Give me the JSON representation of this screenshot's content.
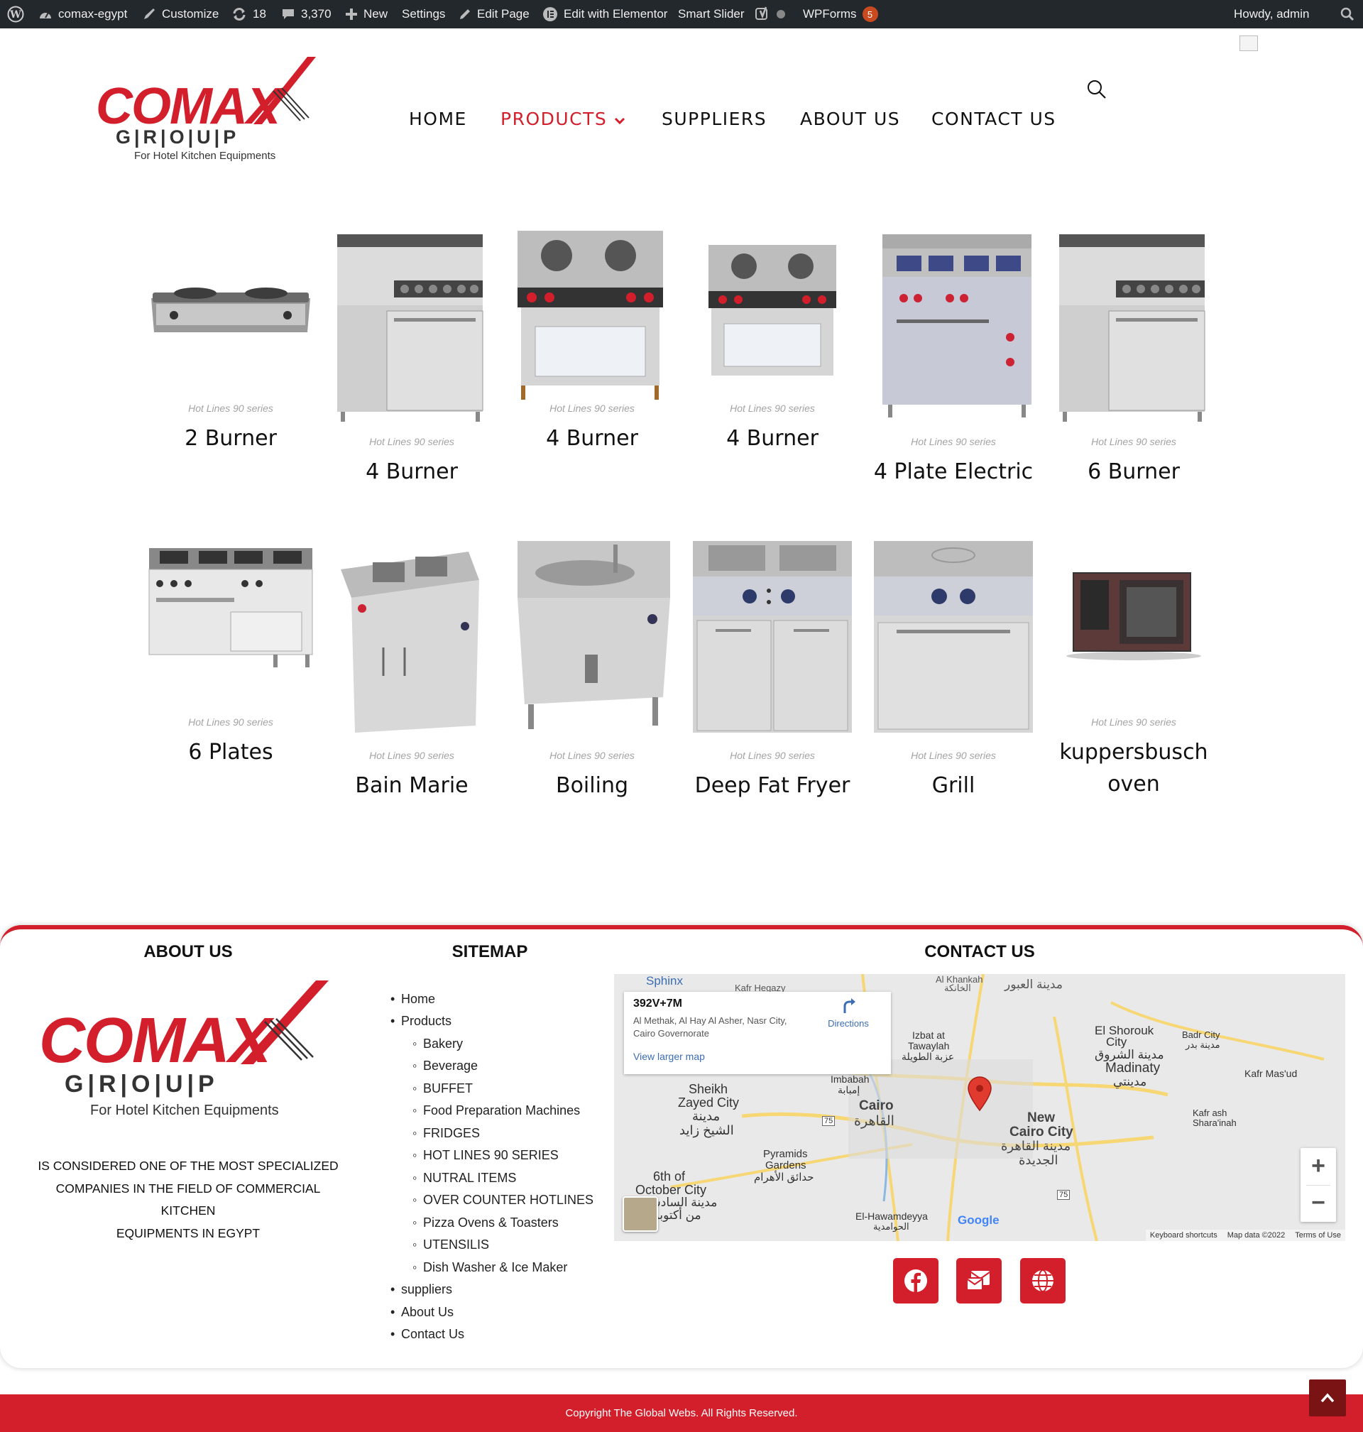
{
  "admin_bar": {
    "site_name": "comax-egypt",
    "customize": "Customize",
    "updates_count": "18",
    "comments_count": "3,370",
    "new": "New",
    "settings": "Settings",
    "edit_page": "Edit Page",
    "edit_elementor": "Edit with Elementor",
    "smart_slider": "Smart Slider",
    "wpforms": "WPForms",
    "wpforms_badge": "5",
    "greeting": "Howdy, admin"
  },
  "logo": {
    "word": "COMAX",
    "group": "G|R|O|U|P",
    "tagline": "For Hotel Kitchen Equipments"
  },
  "nav": {
    "home": "HOME",
    "products": "PRODUCTS",
    "suppliers": "SUPPLIERS",
    "about": "ABOUT US",
    "contact": "CONTACT US"
  },
  "products": [
    {
      "category": "Hot Lines 90 series",
      "name": "2 Burner"
    },
    {
      "category": "Hot Lines 90 series",
      "name": "4 Burner"
    },
    {
      "category": "Hot Lines 90 series",
      "name": "4 Burner"
    },
    {
      "category": "Hot Lines 90 series",
      "name": "4 Burner"
    },
    {
      "category": "Hot Lines 90 series",
      "name": "4 Plate Electric"
    },
    {
      "category": "Hot Lines 90 series",
      "name": "6 Burner"
    },
    {
      "category": "Hot Lines 90 series",
      "name": "6 Plates"
    },
    {
      "category": "Hot Lines 90 series",
      "name": "Bain Marie"
    },
    {
      "category": "Hot Lines 90 series",
      "name": "Boiling"
    },
    {
      "category": "Hot Lines 90 series",
      "name": "Deep Fat Fryer"
    },
    {
      "category": "Hot Lines 90 series",
      "name": "Grill"
    },
    {
      "category": "Hot Lines 90 series",
      "name_line1": "kuppersbusch",
      "name_line2": "oven"
    }
  ],
  "footer": {
    "about_heading": "ABOUT US",
    "sitemap_heading": "SITEMAP",
    "contact_heading": "CONTACT US",
    "about_line1": "IS CONSIDERED ONE OF THE MOST SPECIALIZED",
    "about_line2": "COMPANIES IN THE FIELD OF COMMERCIAL KITCHEN",
    "about_line3": "EQUIPMENTS IN EGYPT",
    "sitemap": {
      "home": "Home",
      "products": "Products",
      "bakery": "Bakery",
      "beverage": "Beverage",
      "buffet": "BUFFET",
      "food_prep": "Food Preparation Machines",
      "fridges": "FRIDGES",
      "hot_lines": "HOT LINES 90 SERIES",
      "nutral": "NUTRAL ITEMS",
      "over_counter": "OVER COUNTER HOTLINES",
      "pizza": "Pizza Ovens & Toasters",
      "utensils": "UTENSILIS",
      "dish": "Dish Washer & Ice Maker",
      "suppliers": "suppliers",
      "about": "About Us",
      "contact": "Contact Us"
    }
  },
  "map": {
    "plus_code": "392V+7M",
    "address_line1": "Al Methak, Al Hay Al Asher, Nasr City,",
    "address_line2": "Cairo Governorate",
    "directions": "Directions",
    "view_larger": "View larger map",
    "labels": {
      "sphinx": "Sphinx",
      "kafr_hegazy": "Kafr Hegazy",
      "al_khankah": "Al Khankah",
      "al_khankah_ar": "الخانكة",
      "obour_ar": "مدينة العبور",
      "el_shorouk": "El Shorouk",
      "city": "City",
      "shorouk_ar": "مدينة الشروق",
      "badr_city": "Badr City",
      "badr_ar": "مدينة بدر",
      "izbat": "Izbat at",
      "tawaylah": "Tawaylah",
      "tawaylah_ar": "عزبة الطويلة",
      "madinaty": "Madinaty",
      "madinaty_ar": "مدينتي",
      "kafr_masud": "Kafr Mas'ud",
      "imbabah": "Imbabah",
      "imbabah_ar": "إمبابة",
      "sheikh": "Sheikh",
      "zayed_city": "Zayed City",
      "zayed_ar1": "مدينة",
      "zayed_ar2": "الشيخ زايد",
      "cairo": "Cairo",
      "cairo_ar": "القاهرة",
      "new": "New",
      "cairo_city": "Cairo City",
      "new_cairo_ar1": "مدينة القاهرة",
      "new_cairo_ar2": "الجديدة",
      "kafr_ash": "Kafr ash",
      "sharainah": "Shara'inah",
      "pyramids": "Pyramids",
      "gardens": "Gardens",
      "pyramids_ar": "حدائق الأهرام",
      "sixth": "6th of",
      "october": "October City",
      "october_ar1": "مدينة السادس",
      "october_ar2": "من أكتوبر",
      "hawamdeyya": "El-Hawamdeyya",
      "hawamdeyya_ar": "الحوامدية",
      "road_75": "75",
      "road_75b": "75"
    },
    "google": "Google",
    "keyboard": "Keyboard shortcuts",
    "map_data": "Map data ©2022",
    "terms": "Terms of Use",
    "zoom_in": "+",
    "zoom_out": "−"
  },
  "copyright": "Copyright The Global Webs. All Rights Reserved.",
  "colors": {
    "brand_red": "#d21f2b",
    "admin_bar": "#23282d",
    "badge": "#ca4a1f"
  },
  "icons": [
    "wordpress-icon",
    "dashboard-icon",
    "brush-icon",
    "update-icon",
    "comment-icon",
    "plus-icon",
    "pencil-icon",
    "elementor-icon",
    "yoast-icon",
    "status-dot-icon",
    "search-icon",
    "chevron-down-icon",
    "facebook-icon",
    "mail-icon",
    "globe-icon",
    "map-pin-icon",
    "directions-icon",
    "chevron-up-icon"
  ]
}
